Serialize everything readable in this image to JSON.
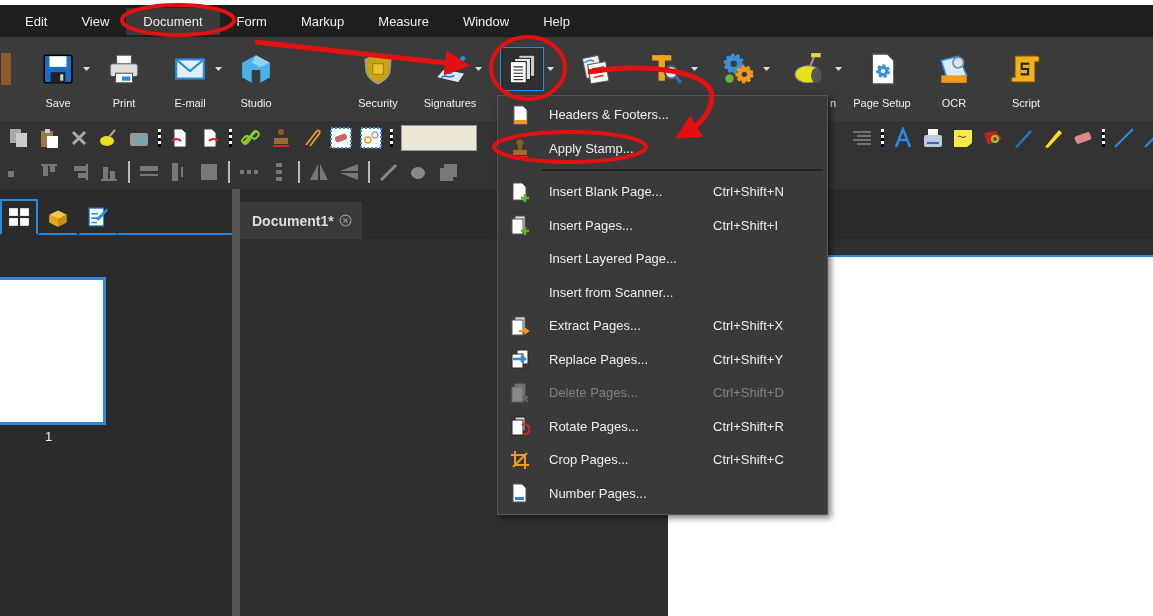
{
  "menubar": [
    {
      "label": "Edit",
      "selected": false
    },
    {
      "label": "View",
      "selected": false
    },
    {
      "label": "Document",
      "selected": true
    },
    {
      "label": "Form",
      "selected": false
    },
    {
      "label": "Markup",
      "selected": false
    },
    {
      "label": "Measure",
      "selected": false
    },
    {
      "label": "Window",
      "selected": false
    },
    {
      "label": "Help",
      "selected": false
    }
  ],
  "toolbar": {
    "groups": [
      [
        {
          "kind": "partial",
          "dropdown": false,
          "selected": false
        },
        {
          "kind": "save",
          "label": "Save",
          "dropdown": true,
          "selected": false
        },
        {
          "kind": "print",
          "label": "Print",
          "dropdown": false,
          "selected": false
        },
        {
          "kind": "email",
          "label": "E-mail",
          "dropdown": true,
          "selected": false
        },
        {
          "kind": "studio",
          "label": "Studio",
          "dropdown": false,
          "selected": false
        }
      ],
      [
        {
          "kind": "security",
          "label": "Security",
          "dropdown": false,
          "selected": false
        },
        {
          "kind": "signatures",
          "label": "Signatures",
          "dropdown": true,
          "selected": false
        },
        {
          "kind": "pages",
          "dropdown": true,
          "selected": true
        },
        {
          "kind": "compare",
          "dropdown": false,
          "selected": false
        },
        {
          "kind": "text-search",
          "dropdown": true,
          "selected": false
        },
        {
          "kind": "gears",
          "dropdown": true,
          "selected": false
        },
        {
          "kind": "measure",
          "label": "n",
          "dropdown": true,
          "selected": false,
          "label_partly_hidden": true
        },
        {
          "kind": "page-setup",
          "label": "Page Setup",
          "dropdown": false,
          "selected": false
        },
        {
          "kind": "ocr",
          "label": "OCR",
          "dropdown": false,
          "selected": false
        },
        {
          "kind": "script",
          "label": "Script",
          "dropdown": false,
          "selected": false
        }
      ]
    ]
  },
  "panel_tabs": [
    {
      "kind": "thumbnails",
      "selected": true
    },
    {
      "kind": "box",
      "selected": false
    },
    {
      "kind": "form",
      "selected": false
    }
  ],
  "thumbnail": {
    "page_number": "1",
    "selected": true
  },
  "document_tab": {
    "title": "Document1*"
  },
  "menu": {
    "sections": [
      [
        {
          "kind": "header-footer",
          "label": "Headers & Footers...",
          "disabled": false
        },
        {
          "kind": "stamp",
          "label": "Apply Stamp...",
          "disabled": false
        }
      ],
      [
        {
          "kind": "insert-blank",
          "label": "Insert Blank Page...",
          "shortcut": "Ctrl+Shift+N",
          "disabled": false
        },
        {
          "kind": "insert-pages",
          "label": "Insert Pages...",
          "shortcut": "Ctrl+Shift+I",
          "disabled": false
        },
        {
          "kind": "none",
          "label": "Insert Layered Page...",
          "disabled": false
        },
        {
          "kind": "none",
          "label": "Insert from Scanner...",
          "disabled": false
        },
        {
          "kind": "extract",
          "label": "Extract Pages...",
          "shortcut": "Ctrl+Shift+X",
          "disabled": false
        },
        {
          "kind": "replace",
          "label": "Replace Pages...",
          "shortcut": "Ctrl+Shift+Y",
          "disabled": false
        },
        {
          "kind": "delete",
          "label": "Delete Pages...",
          "shortcut": "Ctrl+Shift+D",
          "disabled": true
        },
        {
          "kind": "rotate",
          "label": "Rotate Pages...",
          "shortcut": "Ctrl+Shift+R",
          "disabled": false
        },
        {
          "kind": "crop",
          "label": "Crop Pages...",
          "shortcut": "Ctrl+Shift+C",
          "disabled": false
        },
        {
          "kind": "number",
          "label": "Number Pages...",
          "disabled": false
        }
      ]
    ]
  }
}
